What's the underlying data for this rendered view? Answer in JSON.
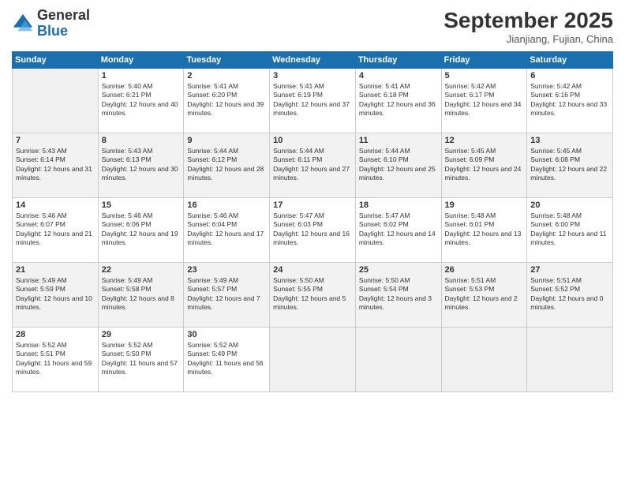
{
  "header": {
    "logo_general": "General",
    "logo_blue": "Blue",
    "month": "September 2025",
    "location": "Jianjiang, Fujian, China"
  },
  "weekdays": [
    "Sunday",
    "Monday",
    "Tuesday",
    "Wednesday",
    "Thursday",
    "Friday",
    "Saturday"
  ],
  "weeks": [
    [
      {
        "empty": true
      },
      {
        "day": "1",
        "sunrise": "Sunrise: 5:40 AM",
        "sunset": "Sunset: 6:21 PM",
        "daylight": "Daylight: 12 hours and 40 minutes."
      },
      {
        "day": "2",
        "sunrise": "Sunrise: 5:41 AM",
        "sunset": "Sunset: 6:20 PM",
        "daylight": "Daylight: 12 hours and 39 minutes."
      },
      {
        "day": "3",
        "sunrise": "Sunrise: 5:41 AM",
        "sunset": "Sunset: 6:19 PM",
        "daylight": "Daylight: 12 hours and 37 minutes."
      },
      {
        "day": "4",
        "sunrise": "Sunrise: 5:41 AM",
        "sunset": "Sunset: 6:18 PM",
        "daylight": "Daylight: 12 hours and 36 minutes."
      },
      {
        "day": "5",
        "sunrise": "Sunrise: 5:42 AM",
        "sunset": "Sunset: 6:17 PM",
        "daylight": "Daylight: 12 hours and 34 minutes."
      },
      {
        "day": "6",
        "sunrise": "Sunrise: 5:42 AM",
        "sunset": "Sunset: 6:16 PM",
        "daylight": "Daylight: 12 hours and 33 minutes."
      }
    ],
    [
      {
        "day": "7",
        "sunrise": "Sunrise: 5:43 AM",
        "sunset": "Sunset: 6:14 PM",
        "daylight": "Daylight: 12 hours and 31 minutes."
      },
      {
        "day": "8",
        "sunrise": "Sunrise: 5:43 AM",
        "sunset": "Sunset: 6:13 PM",
        "daylight": "Daylight: 12 hours and 30 minutes."
      },
      {
        "day": "9",
        "sunrise": "Sunrise: 5:44 AM",
        "sunset": "Sunset: 6:12 PM",
        "daylight": "Daylight: 12 hours and 28 minutes."
      },
      {
        "day": "10",
        "sunrise": "Sunrise: 5:44 AM",
        "sunset": "Sunset: 6:11 PM",
        "daylight": "Daylight: 12 hours and 27 minutes."
      },
      {
        "day": "11",
        "sunrise": "Sunrise: 5:44 AM",
        "sunset": "Sunset: 6:10 PM",
        "daylight": "Daylight: 12 hours and 25 minutes."
      },
      {
        "day": "12",
        "sunrise": "Sunrise: 5:45 AM",
        "sunset": "Sunset: 6:09 PM",
        "daylight": "Daylight: 12 hours and 24 minutes."
      },
      {
        "day": "13",
        "sunrise": "Sunrise: 5:45 AM",
        "sunset": "Sunset: 6:08 PM",
        "daylight": "Daylight: 12 hours and 22 minutes."
      }
    ],
    [
      {
        "day": "14",
        "sunrise": "Sunrise: 5:46 AM",
        "sunset": "Sunset: 6:07 PM",
        "daylight": "Daylight: 12 hours and 21 minutes."
      },
      {
        "day": "15",
        "sunrise": "Sunrise: 5:46 AM",
        "sunset": "Sunset: 6:06 PM",
        "daylight": "Daylight: 12 hours and 19 minutes."
      },
      {
        "day": "16",
        "sunrise": "Sunrise: 5:46 AM",
        "sunset": "Sunset: 6:04 PM",
        "daylight": "Daylight: 12 hours and 17 minutes."
      },
      {
        "day": "17",
        "sunrise": "Sunrise: 5:47 AM",
        "sunset": "Sunset: 6:03 PM",
        "daylight": "Daylight: 12 hours and 16 minutes."
      },
      {
        "day": "18",
        "sunrise": "Sunrise: 5:47 AM",
        "sunset": "Sunset: 6:02 PM",
        "daylight": "Daylight: 12 hours and 14 minutes."
      },
      {
        "day": "19",
        "sunrise": "Sunrise: 5:48 AM",
        "sunset": "Sunset: 6:01 PM",
        "daylight": "Daylight: 12 hours and 13 minutes."
      },
      {
        "day": "20",
        "sunrise": "Sunrise: 5:48 AM",
        "sunset": "Sunset: 6:00 PM",
        "daylight": "Daylight: 12 hours and 11 minutes."
      }
    ],
    [
      {
        "day": "21",
        "sunrise": "Sunrise: 5:49 AM",
        "sunset": "Sunset: 5:59 PM",
        "daylight": "Daylight: 12 hours and 10 minutes."
      },
      {
        "day": "22",
        "sunrise": "Sunrise: 5:49 AM",
        "sunset": "Sunset: 5:58 PM",
        "daylight": "Daylight: 12 hours and 8 minutes."
      },
      {
        "day": "23",
        "sunrise": "Sunrise: 5:49 AM",
        "sunset": "Sunset: 5:57 PM",
        "daylight": "Daylight: 12 hours and 7 minutes."
      },
      {
        "day": "24",
        "sunrise": "Sunrise: 5:50 AM",
        "sunset": "Sunset: 5:55 PM",
        "daylight": "Daylight: 12 hours and 5 minutes."
      },
      {
        "day": "25",
        "sunrise": "Sunrise: 5:50 AM",
        "sunset": "Sunset: 5:54 PM",
        "daylight": "Daylight: 12 hours and 3 minutes."
      },
      {
        "day": "26",
        "sunrise": "Sunrise: 5:51 AM",
        "sunset": "Sunset: 5:53 PM",
        "daylight": "Daylight: 12 hours and 2 minutes."
      },
      {
        "day": "27",
        "sunrise": "Sunrise: 5:51 AM",
        "sunset": "Sunset: 5:52 PM",
        "daylight": "Daylight: 12 hours and 0 minutes."
      }
    ],
    [
      {
        "day": "28",
        "sunrise": "Sunrise: 5:52 AM",
        "sunset": "Sunset: 5:51 PM",
        "daylight": "Daylight: 11 hours and 59 minutes."
      },
      {
        "day": "29",
        "sunrise": "Sunrise: 5:52 AM",
        "sunset": "Sunset: 5:50 PM",
        "daylight": "Daylight: 11 hours and 57 minutes."
      },
      {
        "day": "30",
        "sunrise": "Sunrise: 5:52 AM",
        "sunset": "Sunset: 5:49 PM",
        "daylight": "Daylight: 11 hours and 56 minutes."
      },
      {
        "empty": true
      },
      {
        "empty": true
      },
      {
        "empty": true
      },
      {
        "empty": true
      }
    ]
  ]
}
